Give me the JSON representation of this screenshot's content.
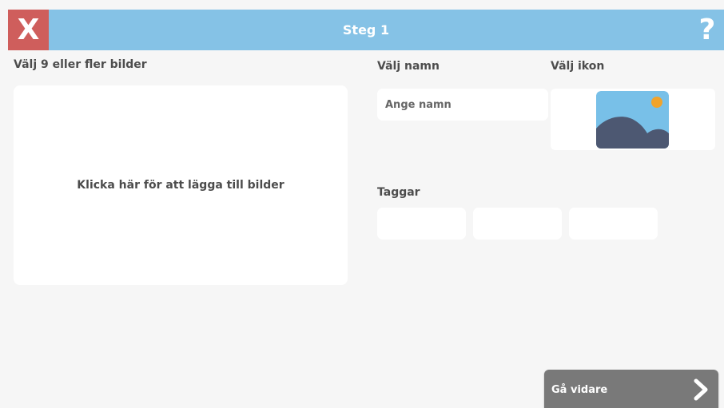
{
  "header": {
    "title": "Steg 1",
    "close_icon": "close-icon",
    "help_icon": "help-icon",
    "close_glyph": "X",
    "help_glyph": "?"
  },
  "images": {
    "label": "Välj 9 eller fler bilder",
    "drop_text": "Klicka här för att lägga till bilder"
  },
  "name": {
    "label": "Välj namn",
    "placeholder": "Ange namn",
    "value": ""
  },
  "icon": {
    "label": "Välj ikon",
    "icon": "image-placeholder-icon"
  },
  "tags": {
    "label": "Taggar",
    "fields": [
      "",
      "",
      ""
    ]
  },
  "footer": {
    "continue_label": "Gå vidare",
    "continue_icon": "chevron-right-icon"
  },
  "colors": {
    "header_bg": "#85c2e6",
    "close_bg": "#cf5e5c",
    "continue_bg": "#797979",
    "page_bg": "#f6f6f6",
    "icon_sky": "#78c0e8",
    "icon_sun": "#f1a32b",
    "icon_hills": "#4d5872"
  }
}
